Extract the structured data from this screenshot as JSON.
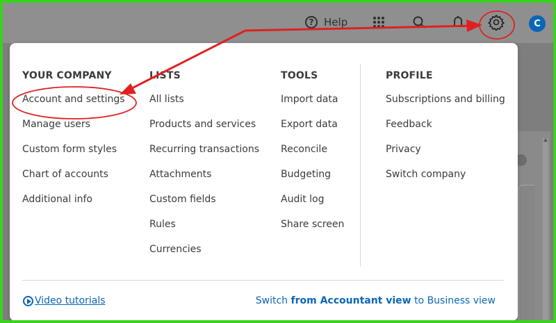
{
  "topbar": {
    "help_label": "Help",
    "icons": [
      "help-icon",
      "apps-grid-icon",
      "search-icon",
      "notifications-bell-icon",
      "settings-gear-icon"
    ],
    "avatar_initial": "C"
  },
  "menu": {
    "columns": [
      {
        "heading": "YOUR COMPANY",
        "items": [
          "Account and settings",
          "Manage users",
          "Custom form styles",
          "Chart of accounts",
          "Additional info"
        ]
      },
      {
        "heading": "LISTS",
        "items": [
          "All lists",
          "Products and services",
          "Recurring transactions",
          "Attachments",
          "Custom fields",
          "Rules",
          "Currencies"
        ]
      },
      {
        "heading": "TOOLS",
        "items": [
          "Import data",
          "Export data",
          "Reconcile",
          "Budgeting",
          "Audit log",
          "Share screen"
        ]
      },
      {
        "heading": "PROFILE",
        "items": [
          "Subscriptions and billing",
          "Feedback",
          "Privacy",
          "Switch company"
        ]
      }
    ],
    "footer": {
      "video_tutorials": "Video tutorials",
      "switch_prefix": "Switch",
      "switch_bold": "from Accountant view",
      "switch_suffix": "to Business view"
    }
  },
  "colors": {
    "frame_border": "#3ad21e",
    "annotation_red": "#e02020",
    "link_blue": "#0a66b5",
    "avatar_blue": "#0b66b5"
  }
}
